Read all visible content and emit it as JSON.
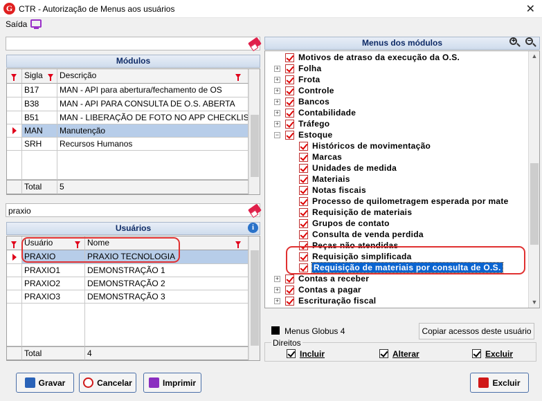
{
  "window": {
    "title": "CTR - Autorização de Menus aos usuários",
    "logo": "G",
    "close": "✕"
  },
  "menubar": {
    "saida": "Saída"
  },
  "modulos": {
    "filter_value": "",
    "header": "Módulos",
    "columns": [
      "Sigla",
      "Descrição"
    ],
    "rows": [
      {
        "sigla": "B17",
        "descricao": "MAN - API para abertura/fechamento de OS"
      },
      {
        "sigla": "B38",
        "descricao": "MAN - API PARA CONSULTA DE O.S. ABERTA"
      },
      {
        "sigla": "B51",
        "descricao": "MAN - LIBERAÇÃO DE FOTO NO APP CHECKLIST"
      },
      {
        "sigla": "MAN",
        "descricao": "Manutenção"
      },
      {
        "sigla": "SRH",
        "descricao": "Recursos Humanos"
      }
    ],
    "total_label": "Total",
    "total_value": "5"
  },
  "usuarios": {
    "filter_value": "praxio",
    "header": "Usuários",
    "info_icon": "i",
    "columns": [
      "Usuário",
      "Nome"
    ],
    "rows": [
      {
        "usuario": "PRAXIO",
        "nome": "PRAXIO TECNOLOGIA"
      },
      {
        "usuario": "PRAXIO1",
        "nome": "DEMONSTRAÇÃO 1"
      },
      {
        "usuario": "PRAXIO2",
        "nome": "DEMONSTRAÇÃO 2"
      },
      {
        "usuario": "PRAXIO3",
        "nome": "DEMONSTRAÇÃO 3"
      }
    ],
    "total_label": "Total",
    "total_value": "4"
  },
  "menus": {
    "header": "Menus dos módulos",
    "tree": [
      {
        "label": "Motivos de atraso da execução da O.S.",
        "level": 0,
        "expander": ""
      },
      {
        "label": "Folha",
        "level": 0,
        "expander": "+"
      },
      {
        "label": "Frota",
        "level": 0,
        "expander": "+"
      },
      {
        "label": "Controle",
        "level": 0,
        "expander": "+"
      },
      {
        "label": "Bancos",
        "level": 0,
        "expander": "+"
      },
      {
        "label": "Contabilidade",
        "level": 0,
        "expander": "+"
      },
      {
        "label": "Tráfego",
        "level": 0,
        "expander": "+"
      },
      {
        "label": "Estoque",
        "level": 0,
        "expander": "−"
      },
      {
        "label": "Históricos de movimentação",
        "level": 1,
        "expander": ""
      },
      {
        "label": "Marcas",
        "level": 1,
        "expander": ""
      },
      {
        "label": "Unidades de medida",
        "level": 1,
        "expander": ""
      },
      {
        "label": "Materiais",
        "level": 1,
        "expander": ""
      },
      {
        "label": "Notas fiscais",
        "level": 1,
        "expander": ""
      },
      {
        "label": "Processo de quilometragem esperada por mate",
        "level": 1,
        "expander": ""
      },
      {
        "label": "Requisição de materiais",
        "level": 1,
        "expander": ""
      },
      {
        "label": "Grupos de contato",
        "level": 1,
        "expander": ""
      },
      {
        "label": "Consulta de venda perdida",
        "level": 1,
        "expander": ""
      },
      {
        "label": "Peças não atendidas",
        "level": 1,
        "expander": ""
      },
      {
        "label": "Requisição simplificada",
        "level": 1,
        "expander": ""
      },
      {
        "label": "Requisição de materiais por consulta de O.S.",
        "level": 1,
        "expander": "",
        "selected": true
      },
      {
        "label": "Contas a receber",
        "level": 0,
        "expander": "+"
      },
      {
        "label": "Contas a pagar",
        "level": 0,
        "expander": "+"
      },
      {
        "label": "Escrituração fiscal",
        "level": 0,
        "expander": "+"
      }
    ],
    "legend_label": "Menus Globus 4",
    "copy_button": "Copiar acessos deste usuário"
  },
  "direitos": {
    "label": "Direitos",
    "incluir": "Incluir",
    "alterar": "Alterar",
    "excluir": "Excluir"
  },
  "buttons": {
    "gravar": "Gravar",
    "cancelar": "Cancelar",
    "imprimir": "Imprimir",
    "excluir": "Excluir"
  },
  "colors": {
    "accent": "#b7cde9",
    "highlight": "#e03030",
    "selected_tree": "#0a64d0"
  }
}
